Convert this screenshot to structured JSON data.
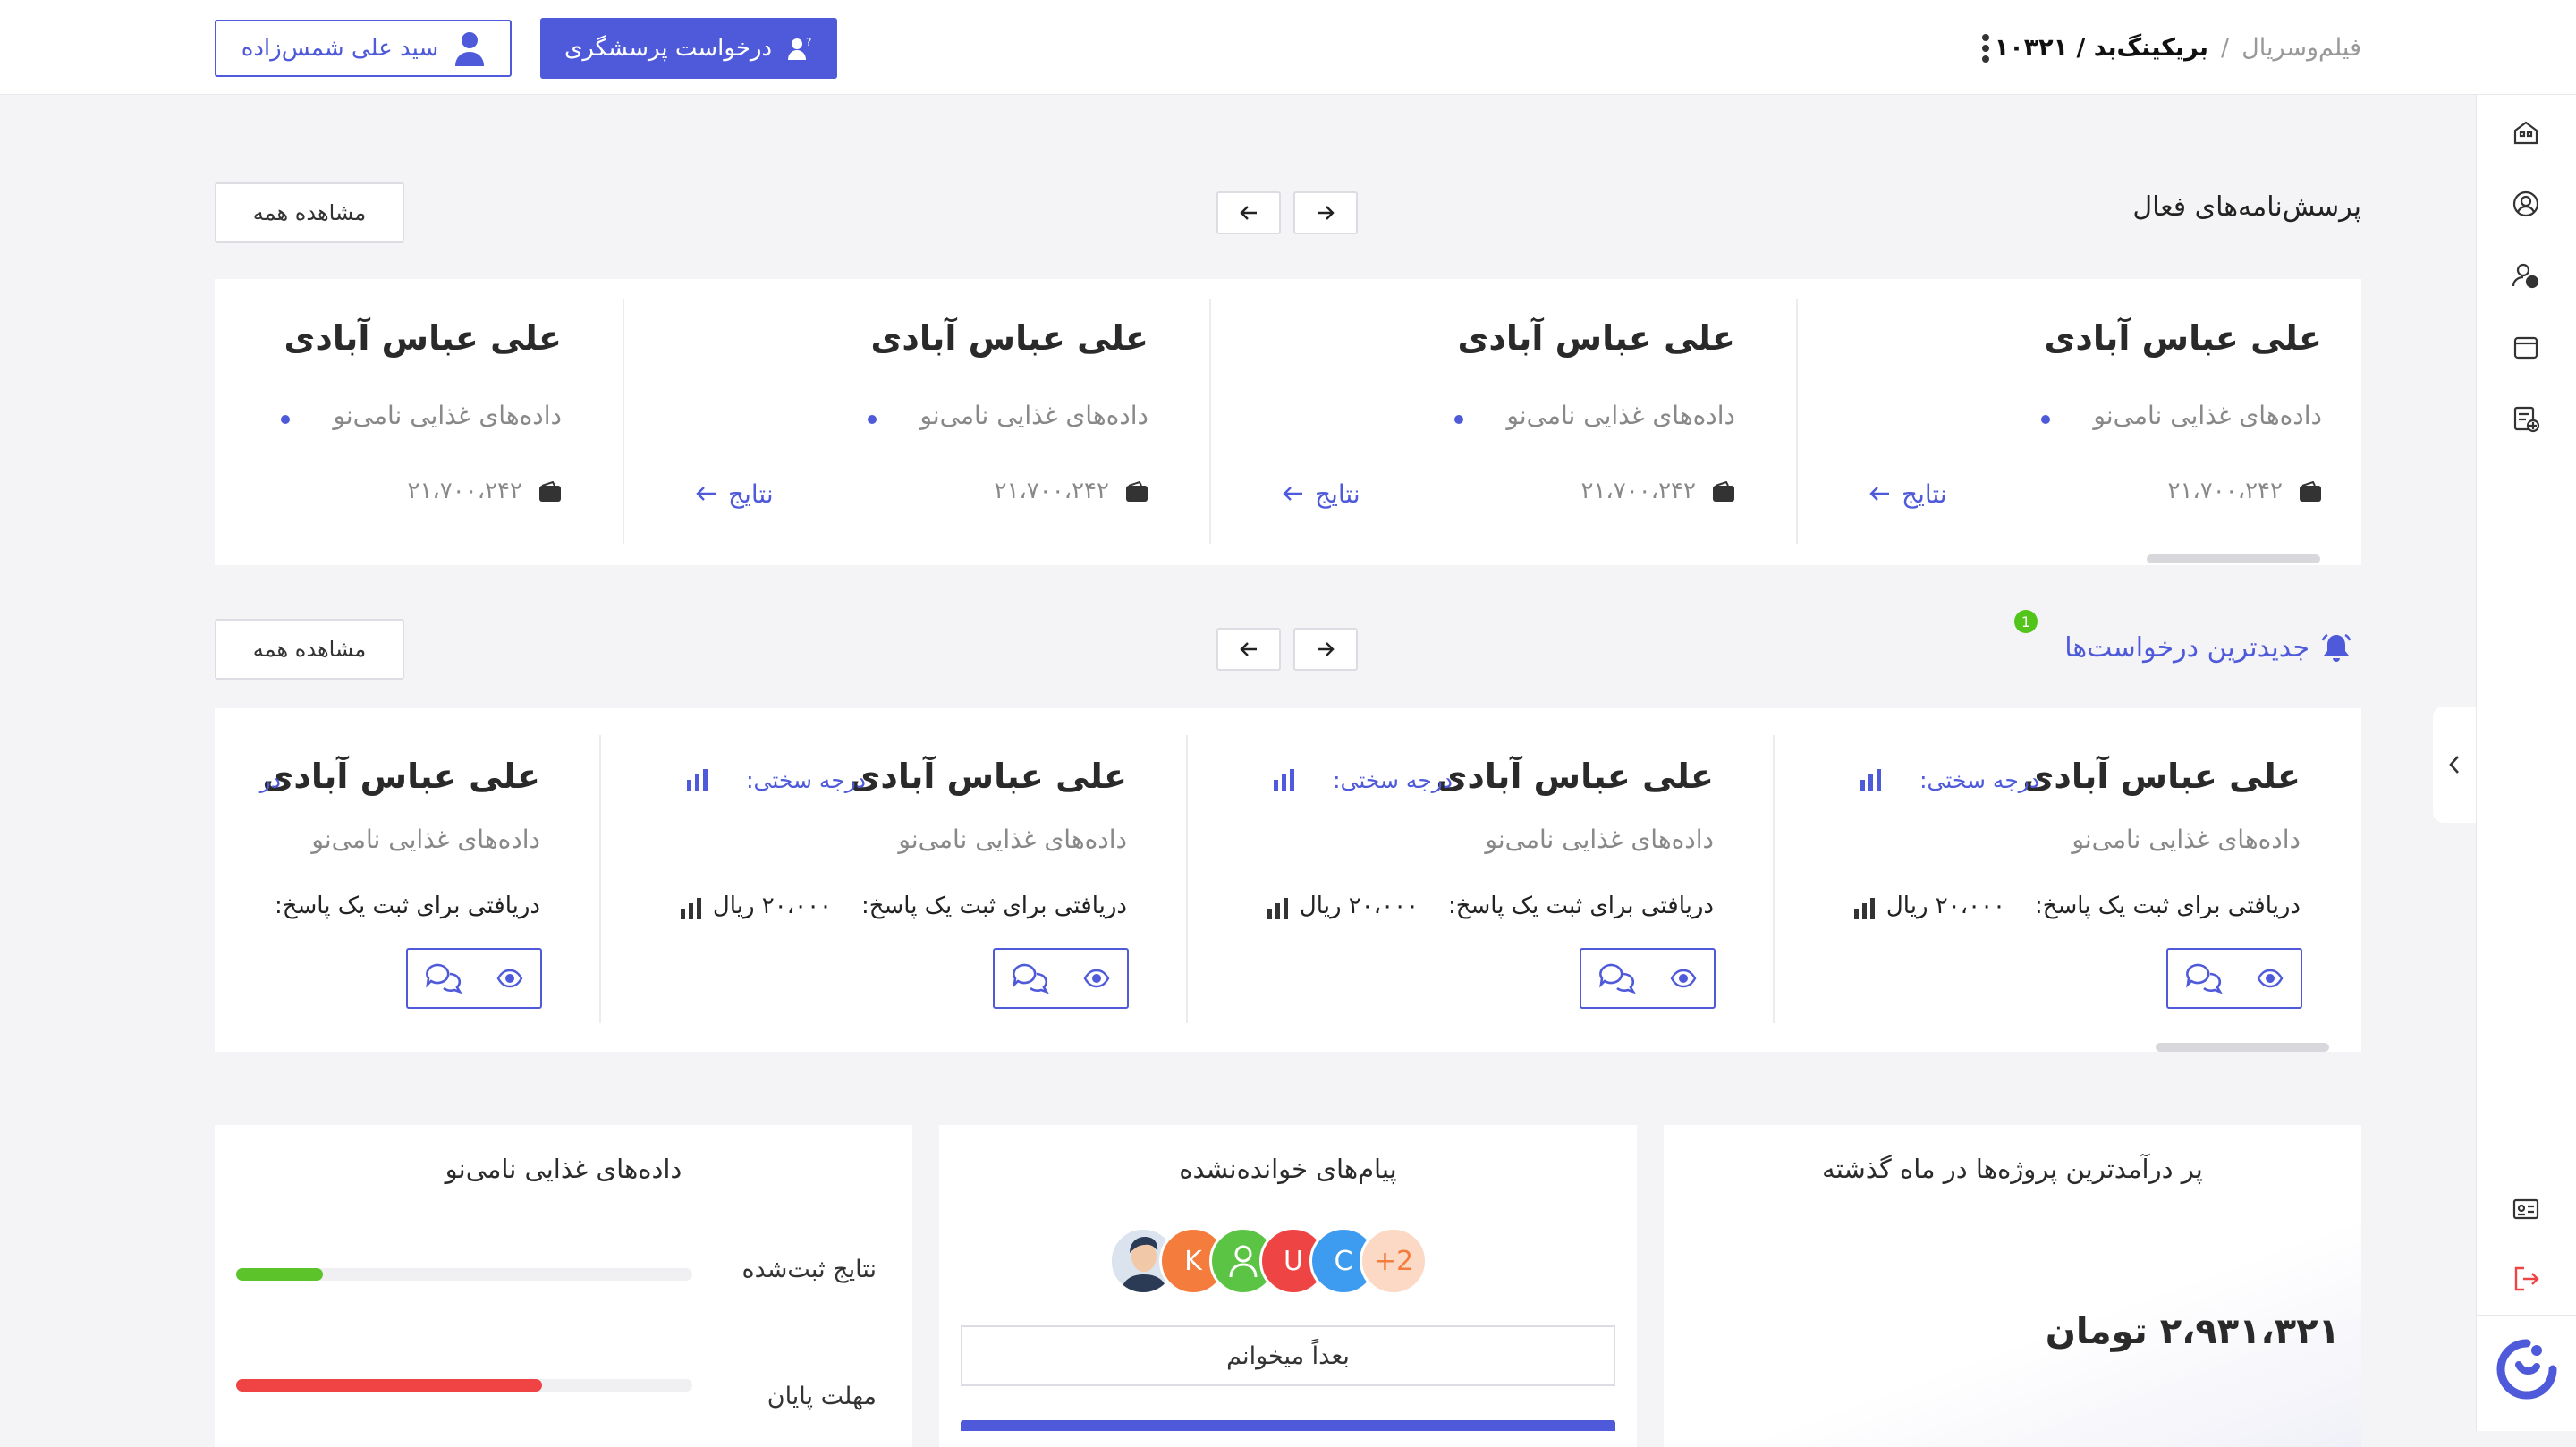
{
  "header": {
    "breadcrumb_root": "فیلم‌وسریال",
    "breadcrumb_sep": "/",
    "breadcrumb_current": "بریکینگ‌بد / ۱۰۳۲۱",
    "request_button": "درخواست پرسشگری",
    "user_name": "سید علی شمس‌زاده"
  },
  "active_surveys": {
    "title": "پرسش‌نامه‌های فعال",
    "see_all": "مشاهده همه",
    "items": [
      {
        "name": "علی عباس آبادی",
        "subtitle": "داده‌های غذایی نامی‌نو",
        "amount": "۲۱،۷۰۰،۲۴۲",
        "link": "نتایج"
      },
      {
        "name": "علی عباس آبادی",
        "subtitle": "داده‌های غذایی نامی‌نو",
        "amount": "۲۱،۷۰۰،۲۴۲",
        "link": "نتایج"
      },
      {
        "name": "علی عباس آبادی",
        "subtitle": "داده‌های غذایی نامی‌نو",
        "amount": "۲۱،۷۰۰،۲۴۲",
        "link": "نتایج"
      },
      {
        "name": "علی عباس آبادی",
        "subtitle": "داده‌های غذایی نامی‌نو",
        "amount": "۲۱،۷۰۰،۲۴۲",
        "link": ""
      }
    ]
  },
  "latest_requests": {
    "title": "جدیدترین درخواست‌ها",
    "badge": "1",
    "see_all": "مشاهده همه",
    "items": [
      {
        "name": "علی عباس آبادی",
        "difficulty": "درجه سختی:",
        "subtitle": "داده‌های غذایی نامی‌نو",
        "pay_label": "دریافتی برای ثبت یک پاسخ:",
        "pay_value": "۲۰،۰۰۰ ریال"
      },
      {
        "name": "علی عباس آبادی",
        "difficulty": "درجه سختی:",
        "subtitle": "داده‌های غذایی نامی‌نو",
        "pay_label": "دریافتی برای ثبت یک پاسخ:",
        "pay_value": "۲۰،۰۰۰ ریال"
      },
      {
        "name": "علی عباس آبادی",
        "difficulty": "درجه سختی:",
        "subtitle": "داده‌های غذایی نامی‌نو",
        "pay_label": "دریافتی برای ثبت یک پاسخ:",
        "pay_value": "۲۰،۰۰۰ ریال"
      },
      {
        "name": "علی عباس آبادی",
        "difficulty": "در",
        "subtitle": "داده‌های غذایی نامی‌نو",
        "pay_label": "دریافتی برای ثبت یک پاسخ:",
        "pay_value": ""
      }
    ]
  },
  "income_card": {
    "title": "پر درآمدترین پروژه‌ها در ماه گذشته",
    "amount": "۲،۹۳۱،۳۲۱ تومان"
  },
  "messages_card": {
    "title": "پیام‌های خوانده‌نشده",
    "avatars": [
      {
        "label": "",
        "color": "#9fb6d4",
        "icon": "person-photo"
      },
      {
        "label": "K",
        "color": "#f47c3c"
      },
      {
        "label": "",
        "color": "#5cc444",
        "icon": "user-icon"
      },
      {
        "label": "U",
        "color": "#ef4444"
      },
      {
        "label": "C",
        "color": "#3e9cf0"
      },
      {
        "label": "+2",
        "color": "#fcd9c4"
      }
    ],
    "read_later": "بعداً میخوانم"
  },
  "food_card": {
    "title": "داده‌های غذایی نامی‌نو",
    "rows": [
      {
        "label": "نتایج ثبت‌شده",
        "value": 0.19,
        "color": "#5cc42a"
      },
      {
        "label": "مهلت پایان",
        "value": 0.67,
        "color": "#f04444"
      }
    ]
  },
  "colors": {
    "accent": "#4e5ad9",
    "badge": "#52c41a"
  }
}
